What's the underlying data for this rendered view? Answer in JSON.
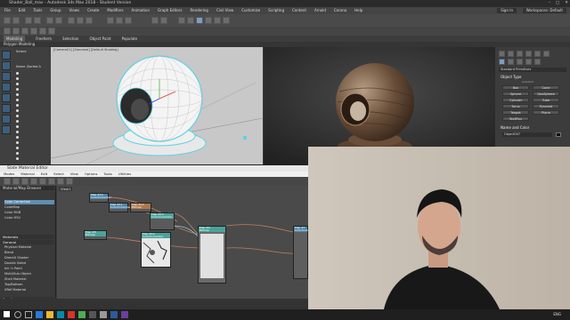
{
  "window": {
    "title": "Shader_Ball_max - Autodesk 3ds Max 2018 - Student Version"
  },
  "menubar": {
    "items": [
      "File",
      "Edit",
      "Tools",
      "Group",
      "Views",
      "Create",
      "Modifiers",
      "Animation",
      "Graph Editors",
      "Rendering",
      "Civil View",
      "Customize",
      "Scripting",
      "Content",
      "Arnold",
      "Corona",
      "Help"
    ],
    "sign_in": "Sign In",
    "workspaces_label": "Workspaces:",
    "workspaces_value": "Default"
  },
  "ribbon": {
    "tabs": [
      "Modeling",
      "Freeform",
      "Selection",
      "Object Paint",
      "Populate"
    ],
    "sub_label": "Polygon Modeling"
  },
  "scene_explorer": {
    "header": "Select",
    "header2": "Name (Sorted A",
    "rows": [
      "",
      "",
      "",
      "",
      "",
      "",
      "",
      "",
      "",
      "",
      "",
      "",
      "",
      "",
      "",
      "",
      ""
    ]
  },
  "viewport_perspective": {
    "label": "[Camera01] [Standard] [Default Shading]"
  },
  "command_panel": {
    "category": "Standard Primitives",
    "object_type_title": "Object Type",
    "autogrid": "AutoGrid",
    "buttons": [
      "Box",
      "Cone",
      "Sphere",
      "GeoSphere",
      "Cylinder",
      "Tube",
      "Torus",
      "Pyramid",
      "Teapot",
      "Plane",
      "TextPlus"
    ],
    "name_color_title": "Name and Color",
    "object_name": "Object007"
  },
  "slate": {
    "title": "Slate Material Editor",
    "menu": [
      "Modes",
      "Material",
      "Edit",
      "Select",
      "View",
      "Options",
      "Tools",
      "Utilities"
    ],
    "browser_title": "Material/Map Browser",
    "browser_items": [
      {
        "label": "Color Correction",
        "selected": true
      },
      {
        "label": "ColorMap",
        "selected": false
      },
      {
        "label": "Color RGB",
        "selected": false
      },
      {
        "label": "Color HSV",
        "selected": false
      }
    ],
    "sections": [
      "Materials",
      "General"
    ],
    "material_items": [
      "Physical Material",
      "Blend",
      "DirectX Shader",
      "Double Sided",
      "Ink 'n Paint",
      "Multi/Sub-Object",
      "Shell Material",
      "Top/Bottom",
      "XRef Material"
    ],
    "scanline_label": "Scanline",
    "view_tab": "View1",
    "status": "Rendering finished",
    "nodes": [
      {
        "id": "n1",
        "title": "Map #10",
        "subtitle": "ColorCorrection"
      },
      {
        "id": "n2",
        "title": "Map #11",
        "subtitle": "ColorCorrection"
      },
      {
        "id": "n3",
        "title": "Map #14",
        "subtitle": "Bitmap"
      },
      {
        "id": "n4",
        "title": "Map #13",
        "subtitle": "ColorCorrection"
      },
      {
        "id": "n5",
        "title": "Map #8",
        "subtitle": "Bitmap"
      },
      {
        "id": "n6",
        "title": "Map #12",
        "subtitle": "ColorCorrection"
      },
      {
        "id": "n7",
        "title": "Map #9",
        "subtitle": "Bitmap"
      },
      {
        "id": "n8",
        "title": "Map #7",
        "subtitle": "ColorCorrection"
      }
    ]
  },
  "taskbar": {
    "time": "",
    "lang": "ENG"
  },
  "colors": {
    "accent_blue": "#4f86a6",
    "node_teal": "#4aa39a",
    "viewport_bg": "#c8c8c8"
  }
}
